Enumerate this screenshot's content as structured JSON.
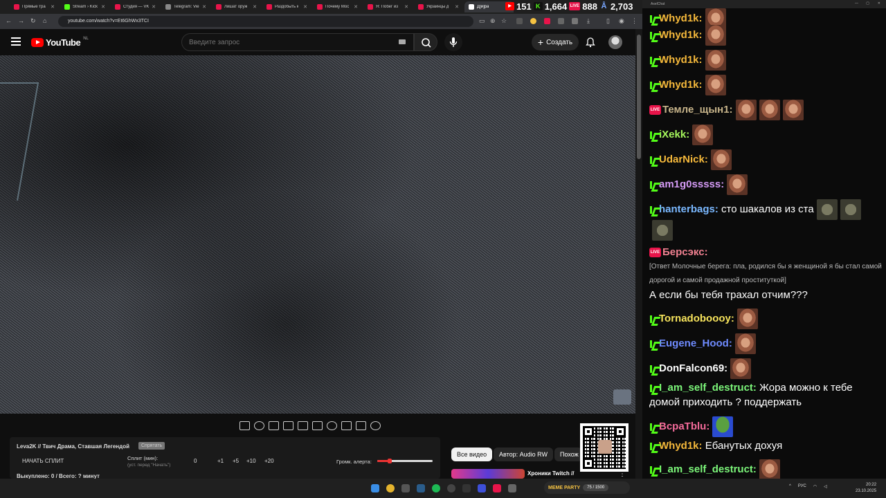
{
  "browser": {
    "tabs": [
      {
        "label": "Прямые тра",
        "color": "#e8144a"
      },
      {
        "label": "Stream › Kick",
        "color": "#53fc18"
      },
      {
        "label": "Студия — VK",
        "color": "#e8144a"
      },
      {
        "label": "Telegram: Vie",
        "color": "#888888"
      },
      {
        "label": "Лишат оруж",
        "color": "#e8144a"
      },
      {
        "label": "Раздобыть к",
        "color": "#e8144a"
      },
      {
        "label": "Почему Мос",
        "color": "#e8144a"
      },
      {
        "label": "Я: Побег из",
        "color": "#e8144a"
      },
      {
        "label": "Украинцы д",
        "color": "#e8144a"
      },
      {
        "label": "Д]и]ра",
        "color": "#ffffff"
      }
    ],
    "url": "youtube.com/watch?v=Et6GhWx3TCI"
  },
  "youtube": {
    "logo_text": "YouTube",
    "region": "NL",
    "search_placeholder": "Введите запрос",
    "create_label": "Создать"
  },
  "stream_counters": [
    {
      "icon": "youtube-icon",
      "value": "151",
      "color": "#ff0000",
      "icon_label": "▶"
    },
    {
      "icon": "kick-icon",
      "value": "1,664",
      "color": "#53fc18",
      "icon_label": "K"
    },
    {
      "icon": "vk-live-icon",
      "value": "888",
      "color": "#e8144a",
      "icon_label": "LIVE"
    },
    {
      "icon": "viewers-icon",
      "value": "2,703",
      "color": "#7aa7ff",
      "icon_label": "Å"
    }
  ],
  "split_panel": {
    "title": "Leva2K // Твич Драма, Ставшая Легендой",
    "badge": "Спрятать",
    "start_button": "НАЧАТЬ СПЛИТ",
    "split_label": "Сплит (мин):",
    "split_hint": "(уст. перед \"Начать\")",
    "split_value": "0",
    "steps": [
      "+1",
      "+5",
      "+10",
      "+20"
    ],
    "volume_label": "Громк. алерта:",
    "volume_level": 0.22,
    "bought": "Выкуплено: 0 / Всего: ? минут"
  },
  "chips": [
    "Все видео",
    "Автор: Audio RW",
    "Похож"
  ],
  "recommended_title": "Хроники Twitch //",
  "chat": {
    "window_title": "AxelChat",
    "messages": [
      {
        "platform": "kick",
        "user": "Whyd1k:",
        "color": "#f6b93b",
        "text": "",
        "emotes": [
          "face"
        ]
      },
      {
        "platform": "kick",
        "user": "Whyd1k:",
        "color": "#f6b93b",
        "text": "",
        "emotes": [
          "face"
        ]
      },
      {
        "platform": "kick",
        "user": "Whyd1k:",
        "color": "#f6b93b",
        "text": "",
        "emotes": [
          "face"
        ]
      },
      {
        "platform": "kick",
        "user": "Whyd1k:",
        "color": "#f6b93b",
        "text": "",
        "emotes": [
          "face"
        ]
      },
      {
        "platform": "vk",
        "user": "Темле_щын1:",
        "color": "#c7b48a",
        "text": "",
        "emotes": [
          "face",
          "face",
          "face"
        ]
      },
      {
        "platform": "kick",
        "user": "iXekk:",
        "color": "#a6f65c",
        "text": "",
        "emotes": [
          "face"
        ]
      },
      {
        "platform": "kick",
        "user": "UdarNick:",
        "color": "#f6b93b",
        "text": "",
        "emotes": [
          "face"
        ]
      },
      {
        "platform": "kick",
        "user": "am1g0sssss:",
        "color": "#d59bf6",
        "text": "",
        "emotes": [
          "face"
        ]
      },
      {
        "platform": "kick",
        "user": "hanterbags:",
        "color": "#7ab8ff",
        "text": "сто шакалов из ста",
        "emotes": [
          "dog",
          "dog",
          "dog"
        ]
      },
      {
        "platform": "vk",
        "user": "Берсэкс:",
        "color": "#f08090",
        "text": "",
        "emotes": []
      },
      {
        "platform": "kick",
        "user": "Tornadobooоy:",
        "color": "#f6e35c",
        "text": "",
        "emotes": [
          "face"
        ]
      },
      {
        "platform": "kick",
        "user": "Eugene_Hood:",
        "color": "#6f8bff",
        "text": "",
        "emotes": [
          "face"
        ]
      },
      {
        "platform": "kick",
        "user": "DonFalcon69:",
        "color": "#ffffff",
        "text": "",
        "emotes": [
          "face"
        ]
      },
      {
        "platform": "kick",
        "user": "I_am_self_destruct:",
        "color": "#7cf67a",
        "text": "Жора можно к тебе домой приходить ? поддержать",
        "emotes": []
      },
      {
        "platform": "kick",
        "user": "BcpaTblu:",
        "color": "#f66b9b",
        "text": "",
        "emotes": [
          "pepe"
        ]
      },
      {
        "platform": "kick",
        "user": "Whyd1k:",
        "color": "#f6b93b",
        "text": "Ебанутых дохуя",
        "emotes": []
      },
      {
        "platform": "kick",
        "user": "I_am_self_destruct:",
        "color": "#7cf67a",
        "text": "",
        "emotes": [
          "face"
        ]
      }
    ],
    "reply_quote": "[Ответ Молочные берега: пла, родился бы я женщиной я бы стал самой дорогой и самой продажной проституткой]",
    "reply_text": "А если бы тебя трахал отчим???"
  },
  "taskbar": {
    "meme_party": "MEME PARTY",
    "meme_progress": "75 / 1500",
    "lang": "РУС",
    "time": "20:22",
    "date": "23.10.2025"
  }
}
